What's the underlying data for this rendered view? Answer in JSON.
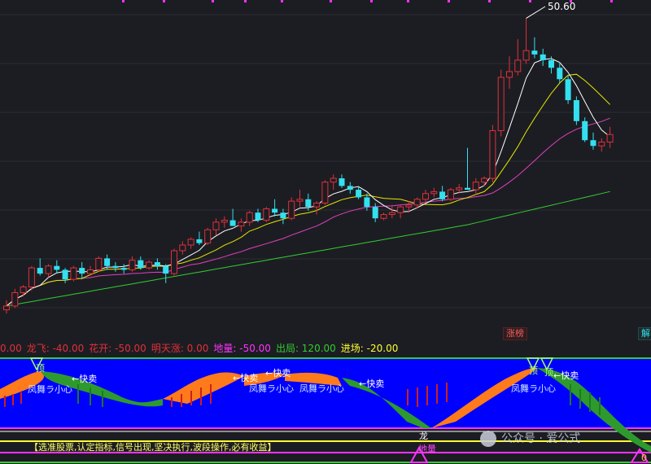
{
  "main": {
    "high_label": "50.60",
    "tag_left": "涨榜",
    "tag_right": "解"
  },
  "legend": [
    {
      "text": "0.00",
      "color": "#e0303c"
    },
    {
      "text": "龙飞: -40.00",
      "color": "#e0303c"
    },
    {
      "text": "花开: -50.00",
      "color": "#e0303c"
    },
    {
      "text": "明天涨: 0.00",
      "color": "#e0303c"
    },
    {
      "text": "地量: -50.00",
      "color": "#ff33ff"
    },
    {
      "text": "出局: 120.00",
      "color": "#33cc33"
    },
    {
      "text": "进场: -20.00",
      "color": "#ffff33"
    }
  ],
  "sub_labels": {
    "quick_sell": "←快卖",
    "phoenix": "凤舞ラ小心",
    "dragon": "龙",
    "low_vol": "地量",
    "top": "顶",
    "banner": "【选准股票,认定指标,信号出现,坚决执行,波段操作,必有收益】",
    "marker": "0"
  },
  "watermark": "公众号 · 爱公式",
  "colors": {
    "bg": "#1c1d22",
    "up": "#e0303c",
    "down": "#33e0f0",
    "ma5": "#ffffff",
    "ma10": "#e6e600",
    "ma20": "#e040c0",
    "ma60": "#33cc33",
    "sub_bg": "#0000ff",
    "sub_orange": "#ff7a1a",
    "sub_green": "#2e9a2e",
    "sub_red": "#cc2020"
  },
  "chart_data": {
    "type": "candlestick",
    "series_order": [
      "open",
      "high",
      "low",
      "close"
    ],
    "candles": [
      [
        20.0,
        21.0,
        19.6,
        20.4
      ],
      [
        20.4,
        22.2,
        20.2,
        21.8
      ],
      [
        21.8,
        22.6,
        21.4,
        22.4
      ],
      [
        22.4,
        24.6,
        22.0,
        24.4
      ],
      [
        24.4,
        25.4,
        23.6,
        23.8
      ],
      [
        23.8,
        24.8,
        23.4,
        24.6
      ],
      [
        24.6,
        25.2,
        23.8,
        24.2
      ],
      [
        24.2,
        24.4,
        22.8,
        23.2
      ],
      [
        23.2,
        24.6,
        23.0,
        24.4
      ],
      [
        24.4,
        25.0,
        23.2,
        23.8
      ],
      [
        23.8,
        24.6,
        23.6,
        24.2
      ],
      [
        24.2,
        25.6,
        24.0,
        25.4
      ],
      [
        25.4,
        25.8,
        24.2,
        24.6
      ],
      [
        24.6,
        25.0,
        24.0,
        24.4
      ],
      [
        24.4,
        24.8,
        23.8,
        24.2
      ],
      [
        24.2,
        25.6,
        24.0,
        25.2
      ],
      [
        25.2,
        25.6,
        24.2,
        24.4
      ],
      [
        24.4,
        25.2,
        24.2,
        25.0
      ],
      [
        25.0,
        25.4,
        24.2,
        24.6
      ],
      [
        24.6,
        24.8,
        22.8,
        23.8
      ],
      [
        23.8,
        26.4,
        23.6,
        26.2
      ],
      [
        26.2,
        27.2,
        25.8,
        26.8
      ],
      [
        26.8,
        27.6,
        26.4,
        27.4
      ],
      [
        27.4,
        28.2,
        26.8,
        27.0
      ],
      [
        27.0,
        28.6,
        26.8,
        28.4
      ],
      [
        28.4,
        29.6,
        27.8,
        29.2
      ],
      [
        29.2,
        29.8,
        28.6,
        29.4
      ],
      [
        29.4,
        30.6,
        28.8,
        28.8
      ],
      [
        28.8,
        29.6,
        28.2,
        29.2
      ],
      [
        29.2,
        30.4,
        28.8,
        30.2
      ],
      [
        30.2,
        30.6,
        29.2,
        29.4
      ],
      [
        29.4,
        30.8,
        29.2,
        30.6
      ],
      [
        30.6,
        31.6,
        29.8,
        30.2
      ],
      [
        30.2,
        30.6,
        29.0,
        29.6
      ],
      [
        29.6,
        31.8,
        29.4,
        31.4
      ],
      [
        31.4,
        32.6,
        30.8,
        31.6
      ],
      [
        31.6,
        32.2,
        30.4,
        30.8
      ],
      [
        30.8,
        31.4,
        30.0,
        31.2
      ],
      [
        31.2,
        33.6,
        31.0,
        33.4
      ],
      [
        33.4,
        34.2,
        32.6,
        33.8
      ],
      [
        33.8,
        34.2,
        32.8,
        33.0
      ],
      [
        33.0,
        33.4,
        32.2,
        32.6
      ],
      [
        32.6,
        33.0,
        31.6,
        31.8
      ],
      [
        31.8,
        32.2,
        30.4,
        30.8
      ],
      [
        30.8,
        31.2,
        29.2,
        29.6
      ],
      [
        29.6,
        30.2,
        29.4,
        30.0
      ],
      [
        30.0,
        31.0,
        29.6,
        30.2
      ],
      [
        30.2,
        31.0,
        29.6,
        30.8
      ],
      [
        30.8,
        31.4,
        30.2,
        31.0
      ],
      [
        31.0,
        31.8,
        30.6,
        31.6
      ],
      [
        31.6,
        32.6,
        31.2,
        32.2
      ],
      [
        32.2,
        32.8,
        31.8,
        32.4
      ],
      [
        32.4,
        33.0,
        31.4,
        31.6
      ],
      [
        31.6,
        32.8,
        31.4,
        32.6
      ],
      [
        32.6,
        33.2,
        32.2,
        32.8
      ],
      [
        32.8,
        37.0,
        32.6,
        32.6
      ],
      [
        32.6,
        33.8,
        32.0,
        33.4
      ],
      [
        33.4,
        34.0,
        33.0,
        33.8
      ],
      [
        33.8,
        39.4,
        33.4,
        38.8
      ],
      [
        38.8,
        45.2,
        38.2,
        44.4
      ],
      [
        44.4,
        46.6,
        43.2,
        45.0
      ],
      [
        45.0,
        48.4,
        44.6,
        46.2
      ],
      [
        46.2,
        50.6,
        45.8,
        47.2
      ],
      [
        47.2,
        48.6,
        46.4,
        46.8
      ],
      [
        46.8,
        47.4,
        45.6,
        46.2
      ],
      [
        46.2,
        46.6,
        44.8,
        45.4
      ],
      [
        45.4,
        46.0,
        43.8,
        44.2
      ],
      [
        44.2,
        44.6,
        41.6,
        42.0
      ],
      [
        42.0,
        42.4,
        39.4,
        39.8
      ],
      [
        39.8,
        40.2,
        37.6,
        37.8
      ],
      [
        37.8,
        38.6,
        36.8,
        37.2
      ],
      [
        37.2,
        38.0,
        36.6,
        37.6
      ],
      [
        37.6,
        39.2,
        37.0,
        38.4
      ]
    ],
    "ylim": [
      18,
      52
    ],
    "high_price": 50.6
  }
}
